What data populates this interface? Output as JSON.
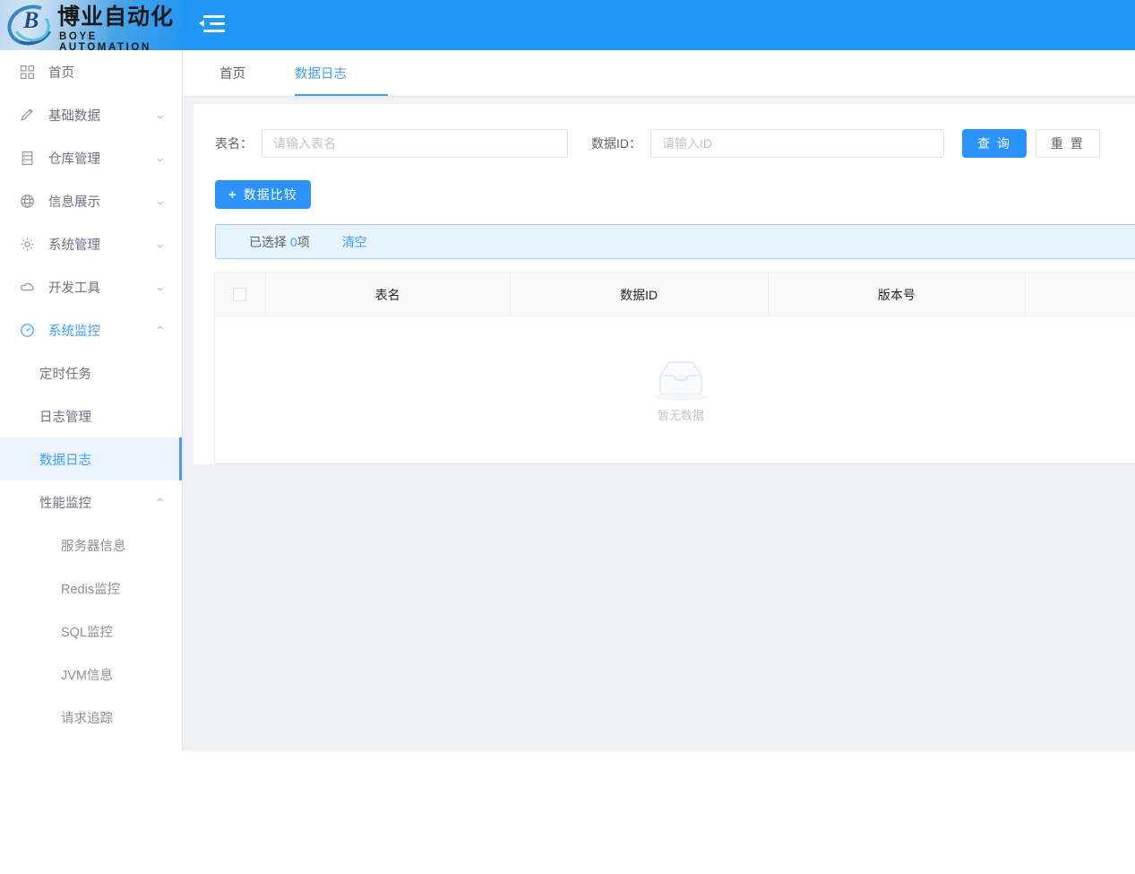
{
  "brand": {
    "logo_mark": "B",
    "name_cn": "博业自动化",
    "name_en": "BOYE AUTOMATION"
  },
  "header": {
    "collapse_icon": "collapse-menu-icon",
    "background_color": "#2196f3"
  },
  "sidebar": {
    "items": [
      {
        "label": "首页",
        "icon": "dashboard-icon",
        "caret": "",
        "active": false
      },
      {
        "label": "基础数据",
        "icon": "pen-icon",
        "caret": "⌄",
        "active": false
      },
      {
        "label": "仓库管理",
        "icon": "warehouse-icon",
        "caret": "⌄",
        "active": false
      },
      {
        "label": "信息展示",
        "icon": "globe-icon",
        "caret": "⌄",
        "active": false
      },
      {
        "label": "系统管理",
        "icon": "gear-icon",
        "caret": "⌄",
        "active": false
      },
      {
        "label": "开发工具",
        "icon": "cloud-icon",
        "caret": "⌄",
        "active": false
      },
      {
        "label": "系统监控",
        "icon": "monitor-icon",
        "caret": "⌃",
        "active": true
      }
    ],
    "submenu": [
      {
        "label": "定时任务",
        "caret": "",
        "current": false
      },
      {
        "label": "日志管理",
        "caret": "",
        "current": false
      },
      {
        "label": "数据日志",
        "caret": "",
        "current": true
      },
      {
        "label": "性能监控",
        "caret": "⌃",
        "current": false
      }
    ],
    "performance_children": [
      {
        "label": "服务器信息"
      },
      {
        "label": "Redis监控"
      },
      {
        "label": "SQL监控"
      },
      {
        "label": "JVM信息"
      },
      {
        "label": "请求追踪"
      }
    ],
    "accent_color": "#409eff",
    "active_bg": "#ecf5ff"
  },
  "tabs": [
    {
      "label": "首页",
      "active": false
    },
    {
      "label": "数据日志",
      "active": true
    }
  ],
  "search_form": {
    "table_name_label": "表名：",
    "table_name_value": "",
    "table_name_placeholder": "请输入表名",
    "data_id_label": "数据ID：",
    "data_id_value": "",
    "data_id_placeholder": "请输入ID",
    "query_button": "查 询",
    "reset_button": "重 置"
  },
  "toolbar": {
    "compare_icon": "plus-icon",
    "compare_label": "数据比较"
  },
  "selection_bar": {
    "prefix": "已选择",
    "count": "0",
    "suffix": "项",
    "clear_label": "清空",
    "background_color": "#e8f4fd",
    "border_color": "#a0cfff"
  },
  "table": {
    "select_all_checkbox": "header-select-all-checkbox",
    "columns": [
      {
        "key": "selection",
        "label": ""
      },
      {
        "key": "table_name",
        "label": "表名"
      },
      {
        "key": "data_id",
        "label": "数据ID"
      },
      {
        "key": "version",
        "label": "版本号"
      },
      {
        "key": "overflow",
        "label": ""
      }
    ],
    "rows": [],
    "empty_text": "暂无数据",
    "empty_icon": "empty-inbox-icon"
  }
}
